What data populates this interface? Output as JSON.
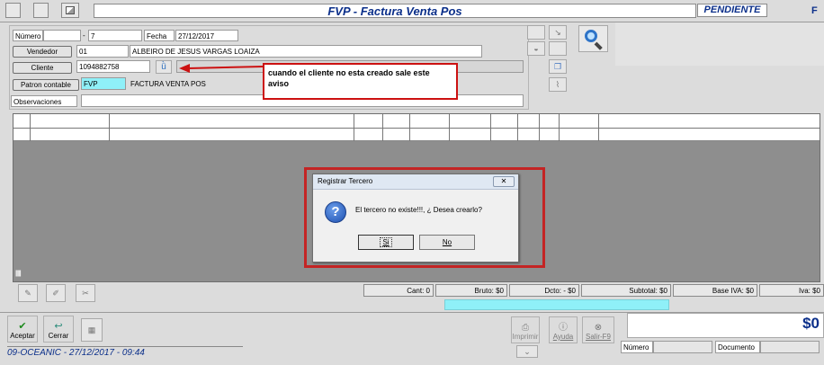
{
  "window": {
    "title": "FVP - Factura Venta Pos",
    "status": "PENDIENTE",
    "right_marker": "F"
  },
  "form": {
    "numero_label": "Número",
    "numero_prefix": "-",
    "numero_value": "7",
    "fecha_label": "Fecha",
    "fecha_value": "27/12/2017",
    "vendedor_button": "Vendedor",
    "vendedor_code": "01",
    "vendedor_name": "ALBEIRO DE JESUS VARGAS LOAIZA",
    "cliente_button": "Cliente",
    "cliente_value": "1094882758",
    "patron_button": "Patron contable",
    "patron_code": "FVP",
    "patron_name": "FACTURA VENTA POS",
    "observaciones_label": "Observaciones"
  },
  "annotation": {
    "text": "cuando el cliente no esta creado sale este aviso",
    "color": "#cc1111"
  },
  "dialog": {
    "title": "Registrar Tercero",
    "close": "✕",
    "message": "El tercero no existe!!!, ¿ Desea crearlo?",
    "yes": "Si",
    "no": "No"
  },
  "grid": {
    "scrollbar_marker": "|||||||"
  },
  "totals": {
    "cant": "Cant: 0",
    "bruto": "Bruto: $0",
    "dcto": "Dcto: - $0",
    "subtotal": "Subtotal: $0",
    "base_iva": "Base IVA: $0",
    "iva": "Iva: $0"
  },
  "footer": {
    "aceptar": "Aceptar",
    "cerrar": "Cerrar",
    "imprimir": "Imprimir",
    "ayuda": "Ayuda",
    "salir": "Salir-F9",
    "total": "$0",
    "numero_label": "Número",
    "documento_label": "Documento",
    "status_line": "09-OCEANIC  -  27/12/2017 - 09:44"
  },
  "colors": {
    "accent": "#0b2f8a",
    "highlight": "#8ff0f8",
    "grid_bg": "#8e8e8e"
  }
}
